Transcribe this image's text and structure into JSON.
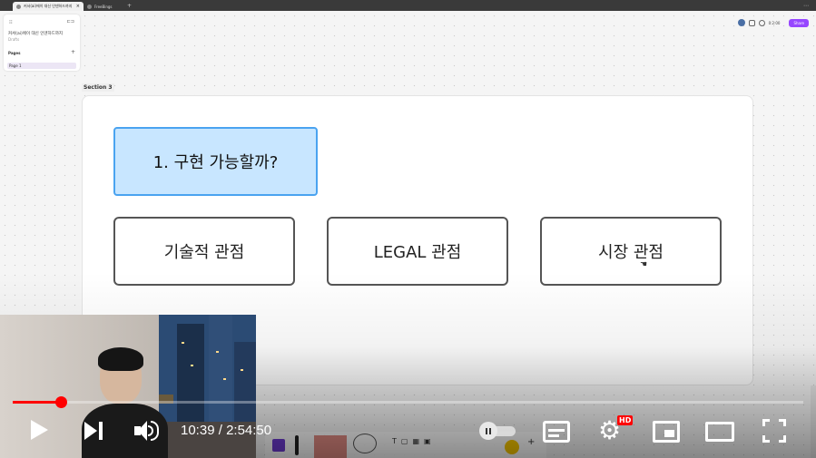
{
  "browser": {
    "tabs": [
      {
        "label": "커서(ai)에이 대신 인덴하드까지",
        "active": true
      },
      {
        "label": "FreeBings",
        "active": false
      }
    ],
    "new_tab": "+",
    "menu": "⋯"
  },
  "figjam": {
    "left_panel": {
      "logo": "⁝⁝",
      "layout_toggle": "⊏⊐",
      "file_name": "커서(ai)에이 대신 인덴하드까지",
      "file_sub": "Drafts",
      "pages_label": "Pages",
      "add_page": "+",
      "page1": "Page 1"
    },
    "top_right": {
      "zoom": "0:2:00",
      "share": "Share"
    },
    "section_label": "Section 3",
    "sticky_title": "1. 구현 가능할까?",
    "boxes": [
      "기술적 관점",
      "LEGAL 관점",
      "시장 관점"
    ],
    "cursor_icon": "hand-cursor-icon"
  },
  "player": {
    "time_current": "10:39",
    "time_separator": " / ",
    "time_total": "2:54:50",
    "progress_fraction": 0.0612,
    "hd_badge": "HD",
    "gear_glyph": "⚙",
    "state": "paused"
  },
  "colors": {
    "progress": "#ff0000",
    "sticky_bg": "#c8e6ff",
    "sticky_border": "#4aa3f0",
    "share": "#9747ff"
  }
}
